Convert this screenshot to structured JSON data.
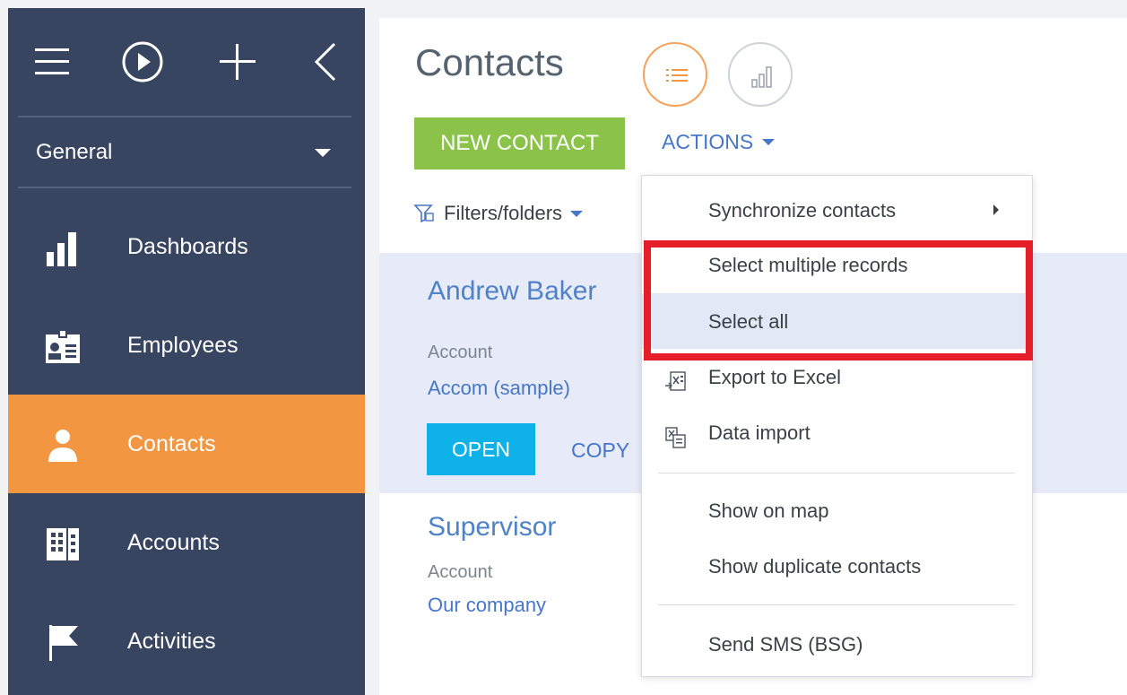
{
  "sidebar": {
    "workspace": "General",
    "items": [
      {
        "label": "Dashboards",
        "icon": "bar-chart-icon"
      },
      {
        "label": "Employees",
        "icon": "id-badge-icon"
      },
      {
        "label": "Contacts",
        "icon": "person-icon"
      },
      {
        "label": "Accounts",
        "icon": "building-icon"
      },
      {
        "label": "Activities",
        "icon": "flag-icon"
      }
    ],
    "active_item": "Contacts"
  },
  "header": {
    "title": "Contacts",
    "new_button": "NEW CONTACT",
    "actions_label": "ACTIONS",
    "filters_label": "Filters/folders"
  },
  "records": [
    {
      "name": "Andrew Baker",
      "account_label": "Account",
      "account": "Accom (sample)",
      "open_label": "OPEN",
      "copy_label": "COPY"
    },
    {
      "name": "Supervisor",
      "account_label": "Account",
      "account": "Our company"
    }
  ],
  "actions_menu": {
    "items": [
      {
        "label": "Synchronize contacts"
      },
      {
        "label": "Select multiple records"
      },
      {
        "label": "Select all"
      },
      {
        "label": "Export to Excel"
      },
      {
        "label": "Data import"
      },
      {
        "label": "Show on map"
      },
      {
        "label": "Show duplicate contacts"
      },
      {
        "label": "Send SMS (BSG)"
      }
    ]
  },
  "colors": {
    "sidebar_bg": "#374560",
    "active_nav": "#f39642",
    "new_button": "#8bc34a",
    "open_button": "#0fb2e8",
    "link": "#4676c8",
    "highlight": "#e61e2a"
  }
}
